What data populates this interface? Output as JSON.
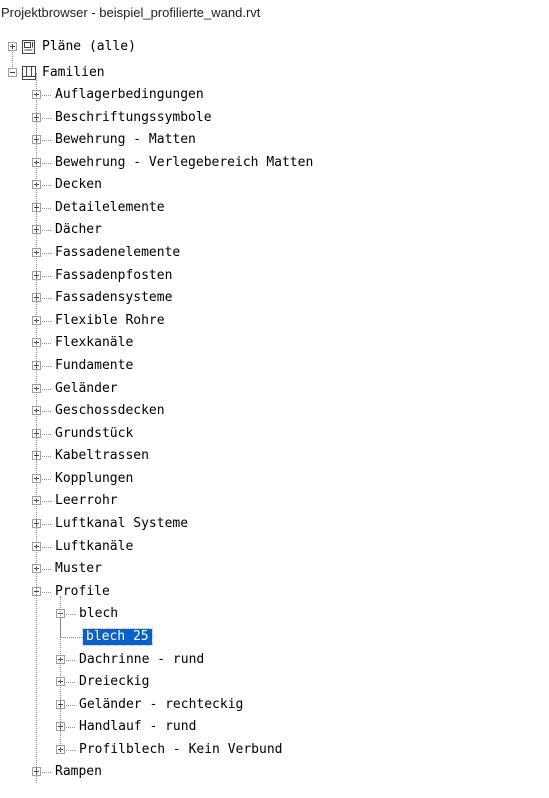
{
  "window": {
    "title": "Projektbrowser - beispiel_profilierte_wand.rvt"
  },
  "tree": {
    "plaene": {
      "label": "Pläne (alle)",
      "icon": "sheet-icon",
      "expanded": false
    },
    "familien": {
      "label": "Familien",
      "icon": "families-icon",
      "expanded": true,
      "categories": [
        "Auflagerbedingungen",
        "Beschriftungssymbole",
        "Bewehrung - Matten",
        "Bewehrung - Verlegebereich Matten",
        "Decken",
        "Detailelemente",
        "Dächer",
        "Fassadenelemente",
        "Fassadenpfosten",
        "Fassadensysteme",
        "Flexible Rohre",
        "Flexkanäle",
        "Fundamente",
        "Geländer",
        "Geschossdecken",
        "Grundstück",
        "Kabeltrassen",
        "Kopplungen",
        "Leerrohr",
        "Luftkanal Systeme",
        "Luftkanäle",
        "Muster"
      ],
      "profile": {
        "label": "Profile",
        "expanded": true,
        "blech": {
          "label": "blech",
          "expanded": true,
          "child": "blech 25",
          "child_selected": true
        },
        "others": [
          "Dachrinne - rund",
          "Dreieckig",
          "Geländer - rechteckig",
          "Handlauf - rund",
          "Profilblech - Kein Verbund"
        ]
      },
      "after": [
        "Rampen"
      ]
    }
  },
  "colors": {
    "selection": "#0b5fc9",
    "connector": "#8a8a8a"
  }
}
